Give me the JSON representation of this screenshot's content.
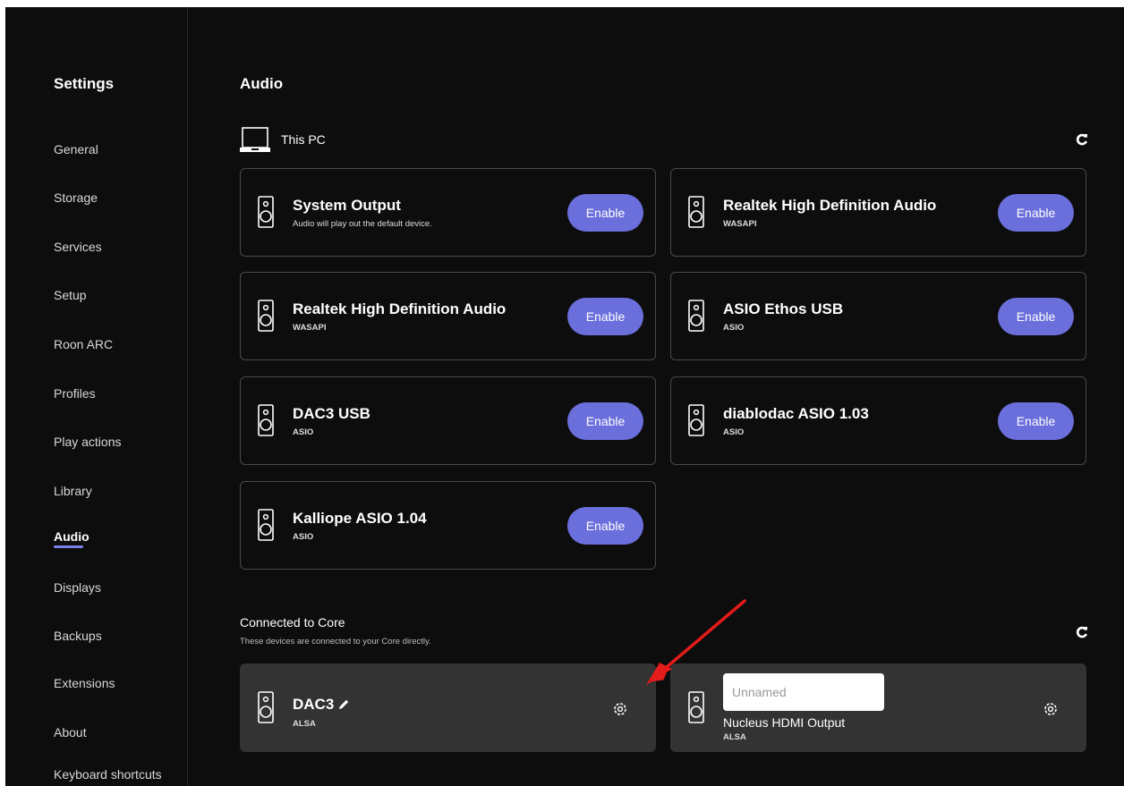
{
  "sidebar": {
    "title": "Settings",
    "items": [
      {
        "label": "General"
      },
      {
        "label": "Storage"
      },
      {
        "label": "Services"
      },
      {
        "label": "Setup"
      },
      {
        "label": "Roon ARC"
      },
      {
        "label": "Profiles"
      },
      {
        "label": "Play actions"
      },
      {
        "label": "Library"
      },
      {
        "label": "Audio",
        "active": true
      },
      {
        "label": "Displays"
      },
      {
        "label": "Backups"
      },
      {
        "label": "Extensions"
      },
      {
        "label": "About"
      },
      {
        "label": "Keyboard shortcuts"
      }
    ]
  },
  "main": {
    "title": "Audio",
    "this_pc": {
      "label": "This PC",
      "refresh_icon": "refresh-icon",
      "devices": [
        {
          "name": "System Output",
          "sub": "Audio will play out the default device.",
          "button": "Enable"
        },
        {
          "name": "Realtek High Definition Audio",
          "sub": "WASAPI",
          "button": "Enable"
        },
        {
          "name": "Realtek High Definition Audio",
          "sub": "WASAPI",
          "button": "Enable"
        },
        {
          "name": "ASIO Ethos USB",
          "sub": "ASIO",
          "button": "Enable"
        },
        {
          "name": "DAC3 USB",
          "sub": "ASIO",
          "button": "Enable"
        },
        {
          "name": "diablodac ASIO 1.03",
          "sub": "ASIO",
          "button": "Enable"
        },
        {
          "name": "Kalliope ASIO 1.04",
          "sub": "ASIO",
          "button": "Enable"
        }
      ]
    },
    "core": {
      "heading": "Connected to Core",
      "description": "These devices are connected to your Core directly.",
      "devices": [
        {
          "name": "DAC3",
          "sub": "ALSA"
        },
        {
          "name_placeholder": "Unnamed",
          "name": "Nucleus HDMI Output",
          "sub": "ALSA"
        }
      ]
    }
  },
  "colors": {
    "background": "#0d0d0d",
    "accent": "#6a6fdb",
    "card_border": "#4a4a4a",
    "core_card": "#333333",
    "annotation_arrow": "#e31b1b"
  }
}
